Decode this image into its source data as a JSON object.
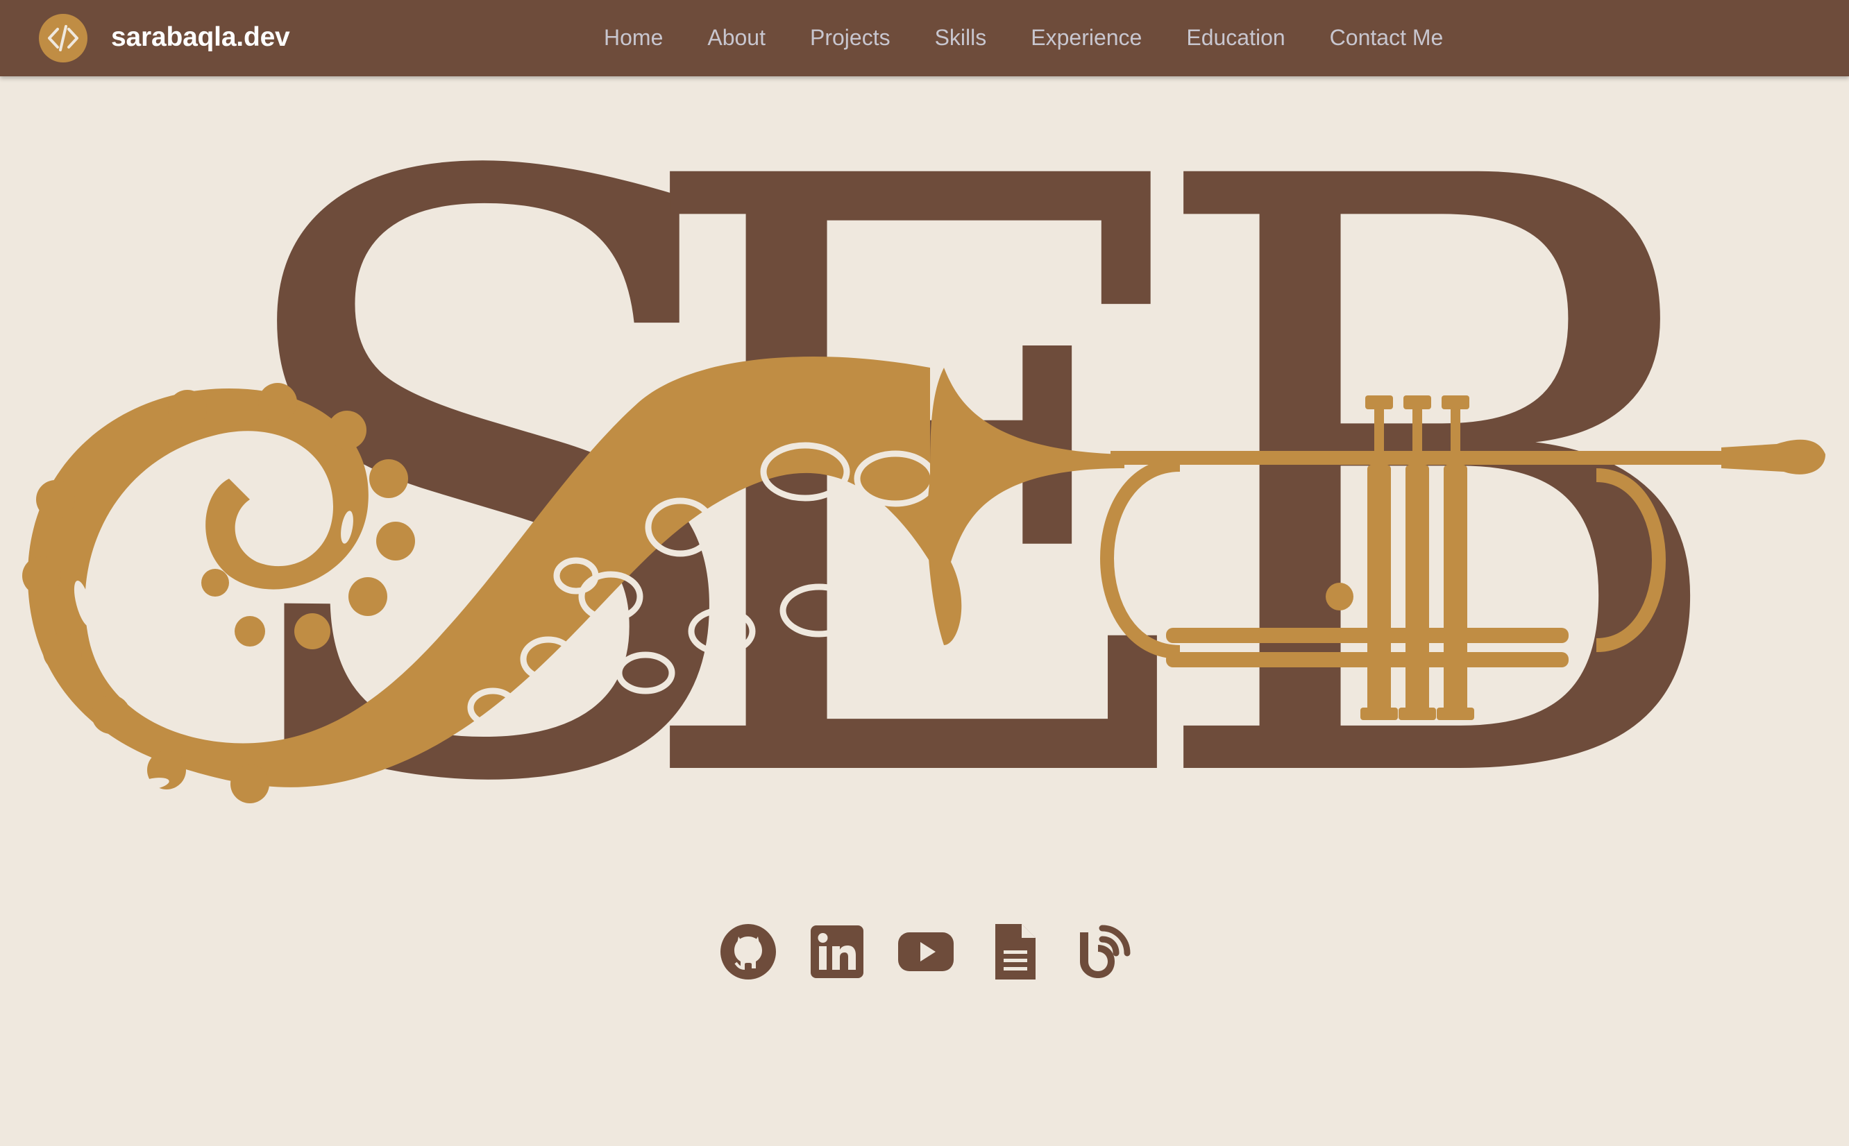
{
  "brand": {
    "name": "sarabaqla.dev",
    "logo_icon": "code-icon",
    "accent": "#c08d44"
  },
  "nav": {
    "items": [
      {
        "label": "Home"
      },
      {
        "label": "About"
      },
      {
        "label": "Projects"
      },
      {
        "label": "Skills"
      },
      {
        "label": "Experience"
      },
      {
        "label": "Education"
      },
      {
        "label": "Contact Me"
      }
    ]
  },
  "hero": {
    "monogram": [
      "S",
      "E",
      "B"
    ],
    "letter_color": "#6e4c3b",
    "artwork_color": "#c08d44",
    "artwork": [
      "octopus-tentacle-illustration",
      "trumpet-illustration"
    ]
  },
  "social": [
    {
      "icon": "github-icon"
    },
    {
      "icon": "linkedin-icon"
    },
    {
      "icon": "youtube-icon"
    },
    {
      "icon": "document-icon"
    },
    {
      "icon": "blog-icon"
    }
  ],
  "colors": {
    "navbar": "#6e4c3b",
    "background": "#efe8de",
    "nav_text": "#c8c6cf"
  }
}
